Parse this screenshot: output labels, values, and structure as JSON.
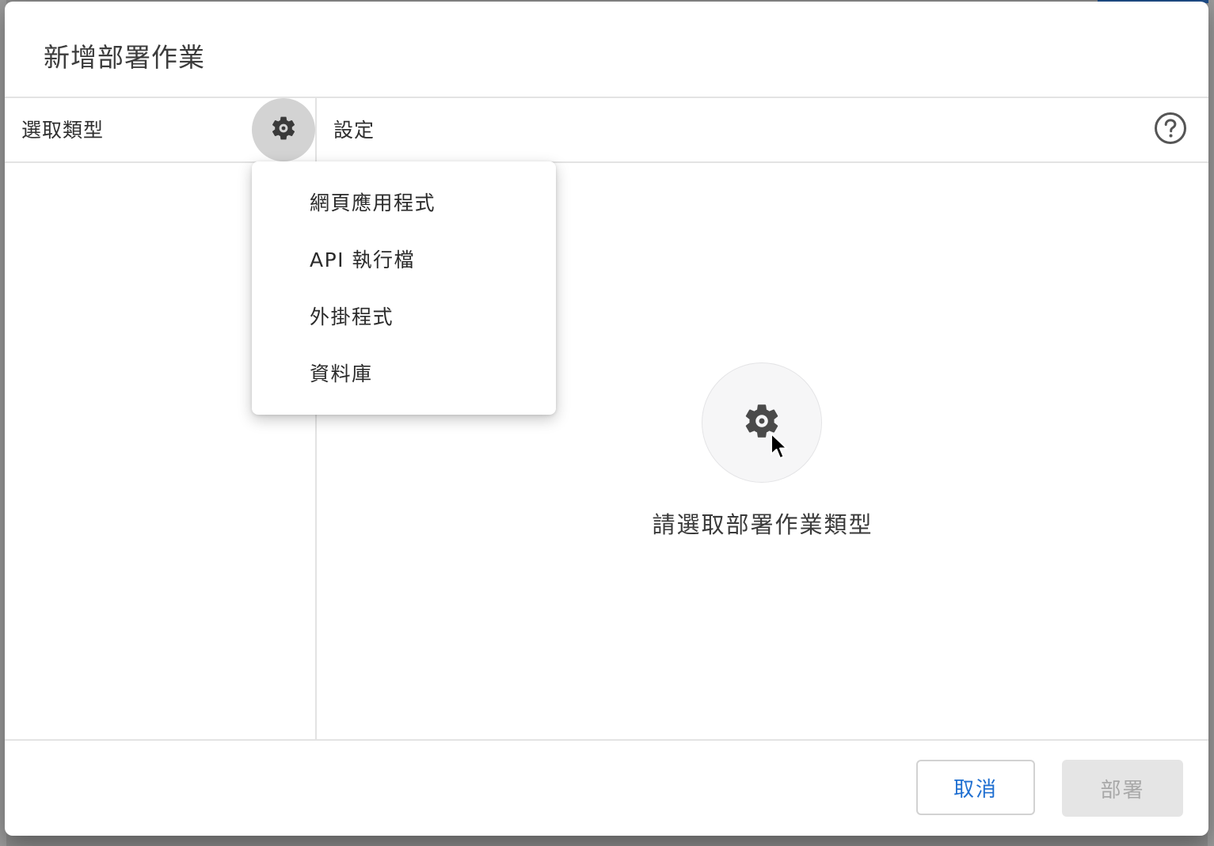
{
  "dialog": {
    "title": "新增部署作業"
  },
  "left_panel": {
    "header_label": "選取類型",
    "type_button_icon": "gear-icon"
  },
  "right_panel": {
    "header_label": "設定",
    "help_icon": "help-circle-icon",
    "empty_state": {
      "icon": "gear-icon",
      "message": "請選取部署作業類型"
    }
  },
  "type_menu": {
    "items": [
      {
        "label": "網頁應用程式"
      },
      {
        "label": "API 執行檔"
      },
      {
        "label": "外掛程式"
      },
      {
        "label": "資料庫"
      }
    ]
  },
  "footer": {
    "cancel_label": "取消",
    "deploy_label": "部署"
  },
  "colors": {
    "accent": "#1f6fd1",
    "disabled_text": "#a8a8a8",
    "disabled_bg": "#e5e5e5"
  }
}
